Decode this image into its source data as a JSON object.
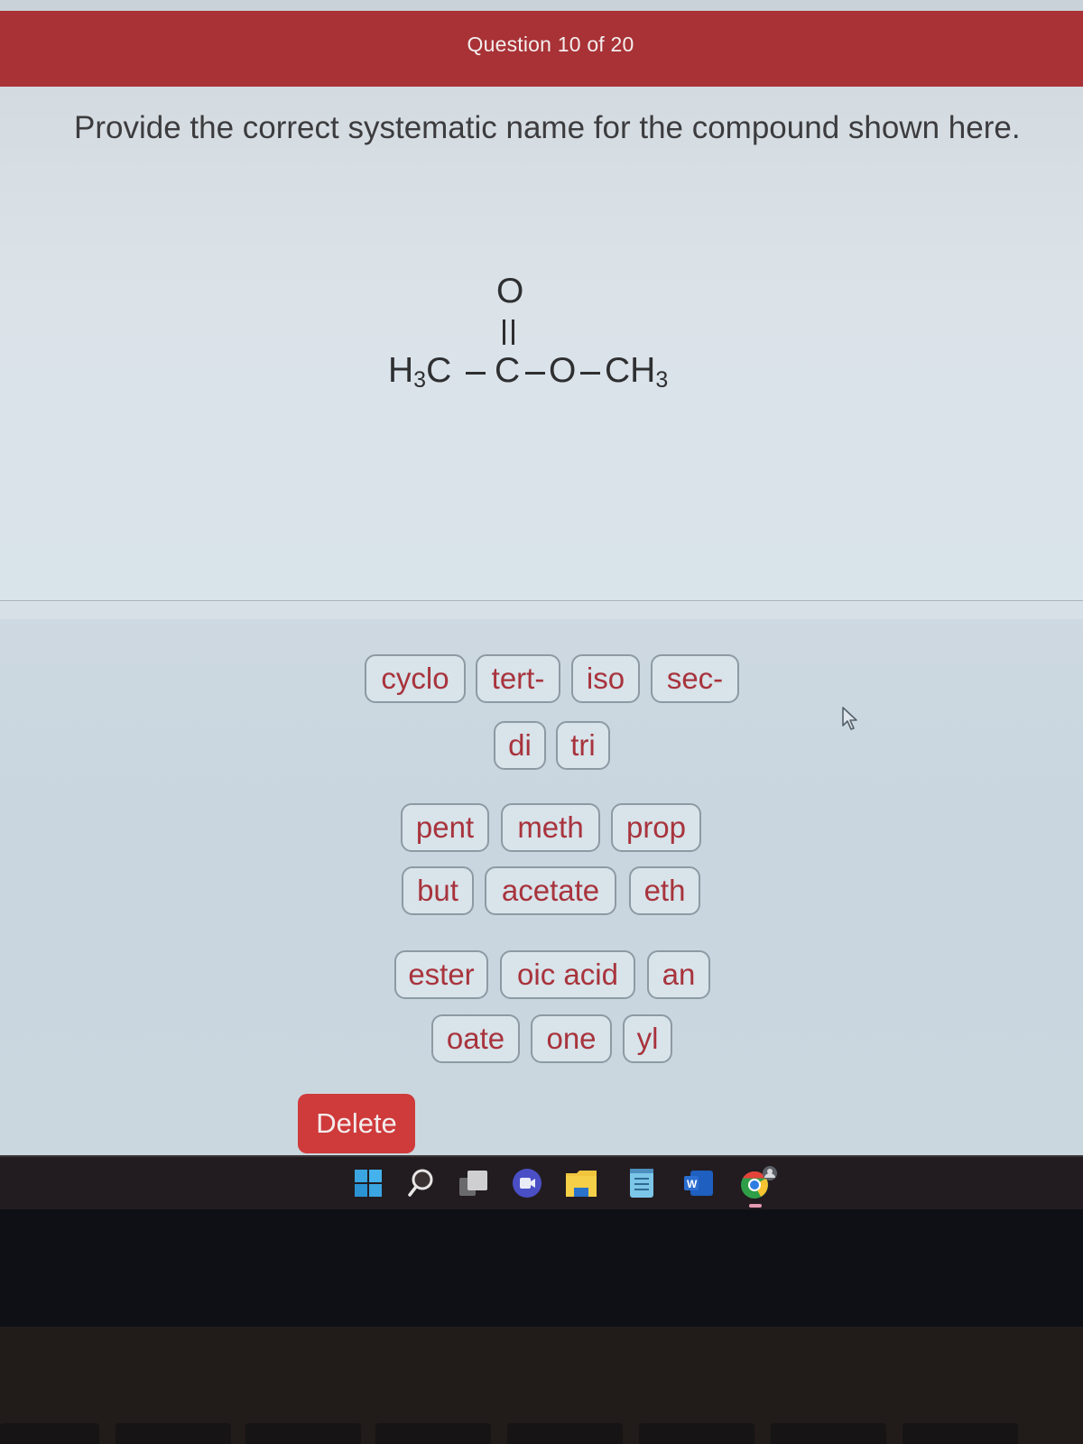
{
  "header": {
    "title": "Question 10 of 20"
  },
  "question": {
    "prompt": "Provide the correct systematic name for the compound shown here.",
    "structure": {
      "left_group": "H3C",
      "left_group_main": "H",
      "left_group_sub": "3",
      "left_group_tail": "C",
      "carbonyl_carbon": "C",
      "carbonyl_oxygen": "O",
      "ester_oxygen": "O",
      "right_group_main": "CH",
      "right_group_sub": "3",
      "formula_description": "CH3-C(=O)-O-CH3"
    }
  },
  "answer": {
    "current_value": ""
  },
  "tiles": {
    "row1": [
      "cyclo",
      "tert-",
      "iso",
      "sec-"
    ],
    "row2": [
      "di",
      "tri"
    ],
    "row3": [
      "pent",
      "meth",
      "prop"
    ],
    "row4": [
      "but",
      "acetate",
      "eth"
    ],
    "row5": [
      "ester",
      "oic acid",
      "an"
    ],
    "row6": [
      "oate",
      "one",
      "yl"
    ]
  },
  "actions": {
    "delete_label": "Delete"
  },
  "taskbar": {
    "icons": [
      "windows-start-icon",
      "search-icon",
      "task-view-icon",
      "meet-chat-icon",
      "file-explorer-icon",
      "notepad-icon",
      "word-icon",
      "chrome-profile-icon"
    ],
    "word_letter": "W"
  },
  "colors": {
    "header_bg": "#a83236",
    "tile_text": "#a8333c",
    "delete_bg": "#cf3a3b"
  }
}
